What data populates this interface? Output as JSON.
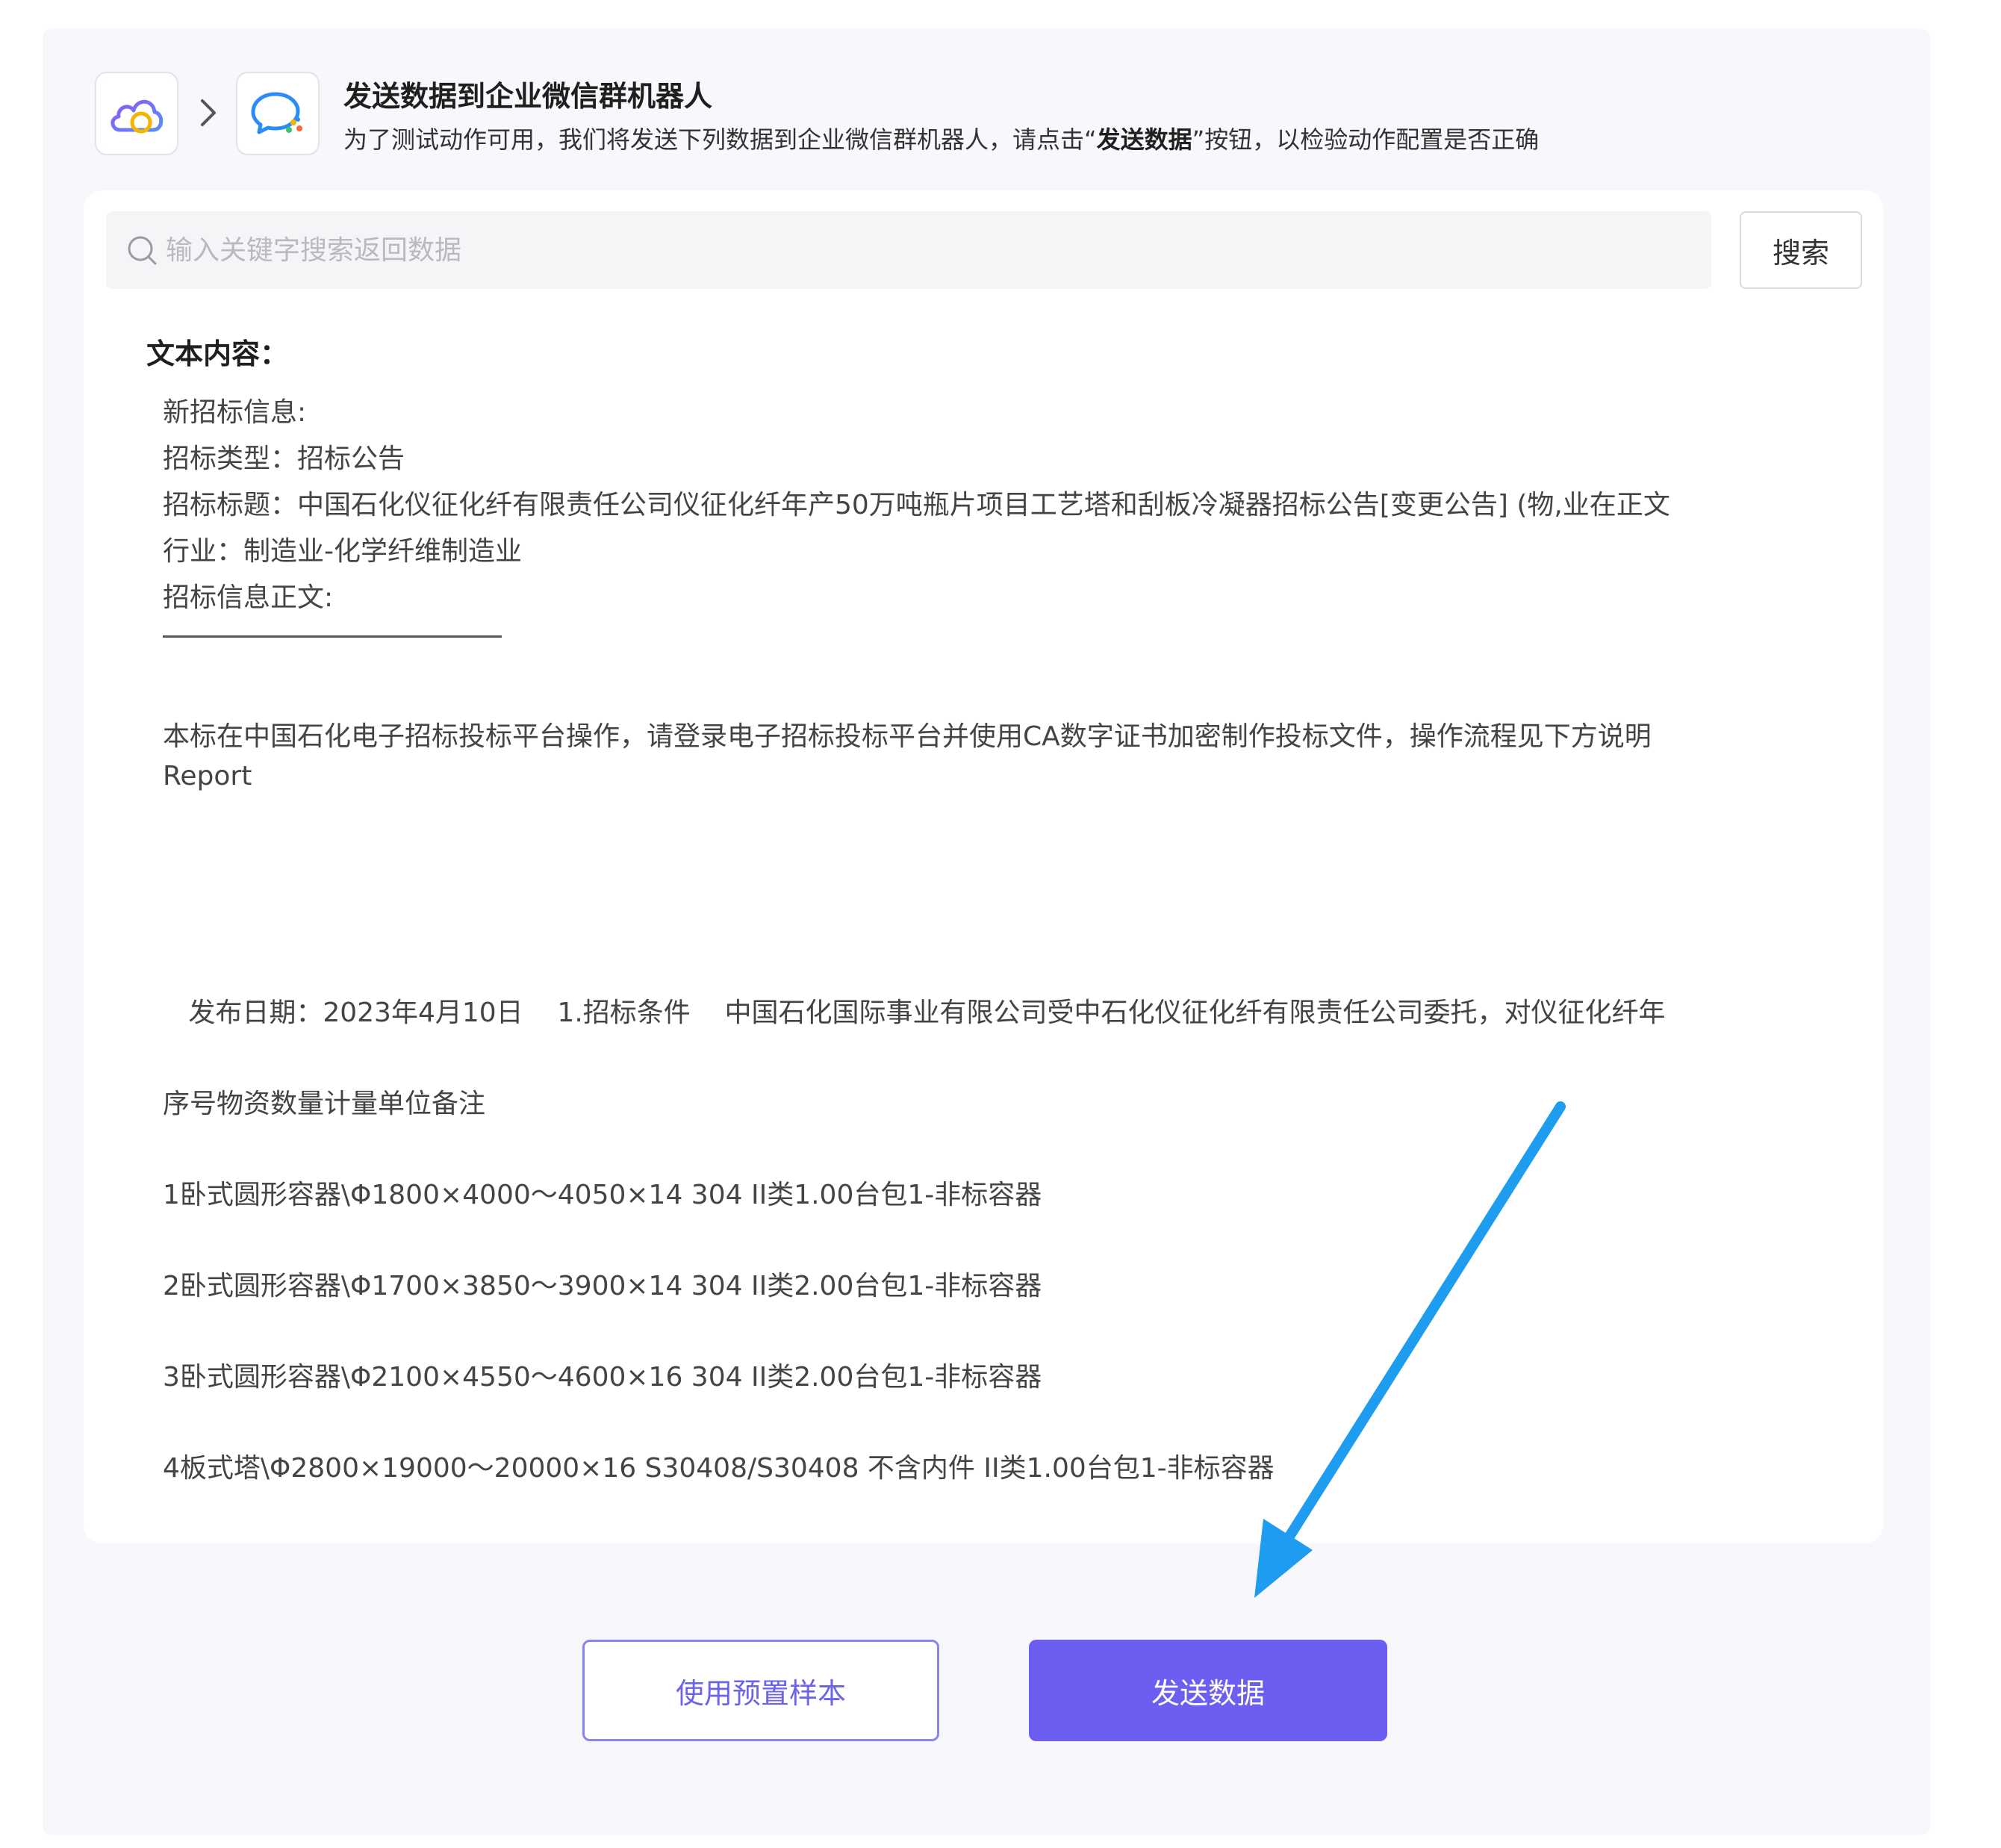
{
  "header": {
    "title": "发送数据到企业微信群机器人",
    "desc_before": "为了测试动作可用，我们将发送下列数据到企业微信群机器人，请点击“",
    "desc_bold": "发送数据",
    "desc_after": "”按钮，以检验动作配置是否正确"
  },
  "icons": {
    "source": "cloud-icon",
    "separator": "chevron-right-icon",
    "target": "wechat-work-bot-icon",
    "search": "search-icon",
    "annotation": "arrow-annotation"
  },
  "colors": {
    "accent": "#6c5ef0",
    "panel_bg": "#f7f7fc",
    "annotation_arrow": "#1e9cf0"
  },
  "search": {
    "placeholder": "输入关键字搜索返回数据",
    "button_label": "搜索"
  },
  "content": {
    "heading": "文本内容：",
    "lines": [
      "新招标信息:",
      "招标类型：招标公告",
      "招标标题：中国石化仪征化纤有限责任公司仪征化纤年产50万吨瓶片项目工艺塔和刮板冷凝器招标公告[变更公告] (物,业在正文",
      "行业：制造业-化学纤维制造业",
      "招标信息正文:",
      "本标在中国石化电子招标投标平台操作，请登录电子招标投标平台并使用CA数字证书加密制作投标文件，操作流程见下方说明",
      "Report",
      "   发布日期：2023年4月10日    1.招标条件    中国石化国际事业有限公司受中石化仪征化纤有限责任公司委托，对仪征化纤年",
      "序号物资数量计量单位备注",
      "1卧式圆形容器\\Φ1800×4000～4050×14 304 II类1.00台包1-非标容器",
      "2卧式圆形容器\\Φ1700×3850～3900×14 304 II类2.00台包1-非标容器",
      "3卧式圆形容器\\Φ2100×4550～4600×16 304 II类2.00台包1-非标容器",
      "4板式塔\\Φ2800×19000～20000×16 S30408/S30408 不含内件 II类1.00台包1-非标容器"
    ]
  },
  "actions": {
    "preset_label": "使用预置样本",
    "send_label": "发送数据"
  }
}
